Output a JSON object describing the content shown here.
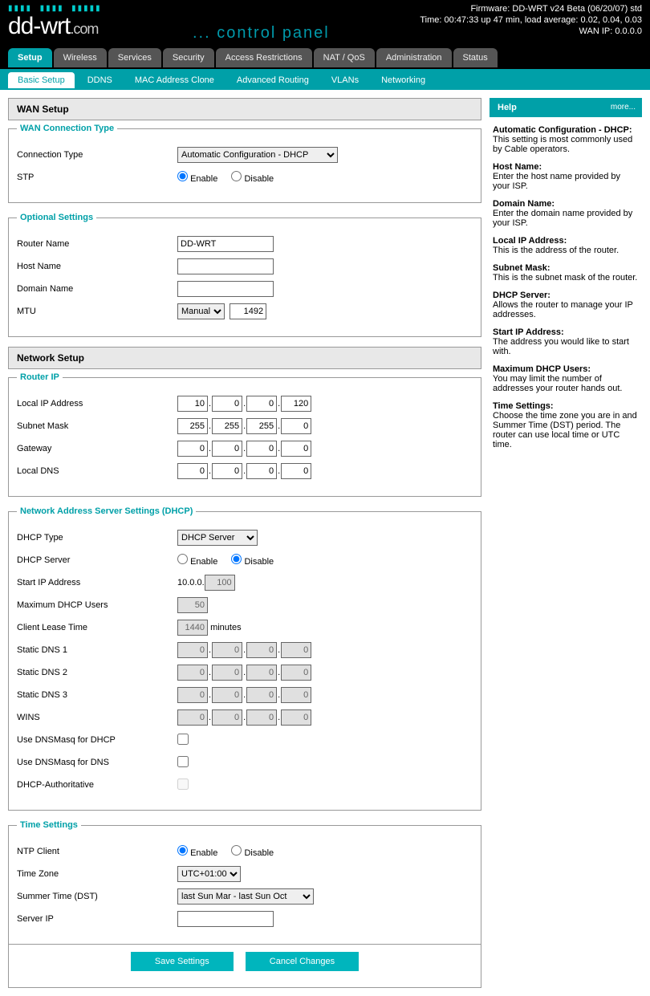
{
  "header": {
    "firmware": "Firmware: DD-WRT v24 Beta (06/20/07) std",
    "time": "Time: 00:47:33 up 47 min, load average: 0.02, 0.04, 0.03",
    "wanip": "WAN IP: 0.0.0.0",
    "logo_main": "dd-wrt",
    "logo_ext": ".com",
    "cp": "... control panel"
  },
  "tabs": {
    "main": [
      "Setup",
      "Wireless",
      "Services",
      "Security",
      "Access Restrictions",
      "NAT / QoS",
      "Administration",
      "Status"
    ],
    "active_main": 0,
    "sub": [
      "Basic Setup",
      "DDNS",
      "MAC Address Clone",
      "Advanced Routing",
      "VLANs",
      "Networking"
    ],
    "active_sub": 0
  },
  "sections": {
    "wan_setup": "WAN Setup",
    "network_setup": "Network Setup"
  },
  "wan": {
    "legend": "WAN Connection Type",
    "conn_label": "Connection Type",
    "conn_value": "Automatic Configuration - DHCP",
    "stp_label": "STP",
    "enable": "Enable",
    "disable": "Disable"
  },
  "optional": {
    "legend": "Optional Settings",
    "router_name_label": "Router Name",
    "router_name": "DD-WRT",
    "host_label": "Host Name",
    "host": "",
    "domain_label": "Domain Name",
    "domain": "",
    "mtu_label": "MTU",
    "mtu_mode": "Manual",
    "mtu": "1492"
  },
  "routerip": {
    "legend": "Router IP",
    "localip_label": "Local IP Address",
    "localip": [
      "10",
      "0",
      "0",
      "120"
    ],
    "subnet_label": "Subnet Mask",
    "subnet": [
      "255",
      "255",
      "255",
      "0"
    ],
    "gateway_label": "Gateway",
    "gateway": [
      "0",
      "0",
      "0",
      "0"
    ],
    "localdns_label": "Local DNS",
    "localdns": [
      "0",
      "0",
      "0",
      "0"
    ]
  },
  "dhcp": {
    "legend": "Network Address Server Settings (DHCP)",
    "type_label": "DHCP Type",
    "type_value": "DHCP Server",
    "server_label": "DHCP Server",
    "enable": "Enable",
    "disable": "Disable",
    "startip_label": "Start IP Address",
    "startip_prefix": "10.0.0.",
    "startip": "100",
    "maxusers_label": "Maximum DHCP Users",
    "maxusers": "50",
    "lease_label": "Client Lease Time",
    "lease": "1440",
    "lease_unit": "minutes",
    "dns1_label": "Static DNS 1",
    "dns1": [
      "0",
      "0",
      "0",
      "0"
    ],
    "dns2_label": "Static DNS 2",
    "dns2": [
      "0",
      "0",
      "0",
      "0"
    ],
    "dns3_label": "Static DNS 3",
    "dns3": [
      "0",
      "0",
      "0",
      "0"
    ],
    "wins_label": "WINS",
    "wins": [
      "0",
      "0",
      "0",
      "0"
    ],
    "dnsmasq_dhcp_label": "Use DNSMasq for DHCP",
    "dnsmasq_dns_label": "Use DNSMasq for DNS",
    "authoritative_label": "DHCP-Authoritative"
  },
  "time": {
    "legend": "Time Settings",
    "ntp_label": "NTP Client",
    "enable": "Enable",
    "disable": "Disable",
    "tz_label": "Time Zone",
    "tz": "UTC+01:00",
    "dst_label": "Summer Time (DST)",
    "dst": "last Sun Mar - last Sun Oct",
    "server_label": "Server IP",
    "server": ""
  },
  "buttons": {
    "save": "Save Settings",
    "cancel": "Cancel Changes"
  },
  "help": {
    "title": "Help",
    "more": "more...",
    "items": [
      {
        "h": "Automatic Configuration - DHCP:",
        "t": "This setting is most commonly used by Cable operators."
      },
      {
        "h": "Host Name:",
        "t": "Enter the host name provided by your ISP."
      },
      {
        "h": "Domain Name:",
        "t": "Enter the domain name provided by your ISP."
      },
      {
        "h": "Local IP Address:",
        "t": "This is the address of the router."
      },
      {
        "h": "Subnet Mask:",
        "t": "This is the subnet mask of the router."
      },
      {
        "h": "DHCP Server:",
        "t": "Allows the router to manage your IP addresses."
      },
      {
        "h": "Start IP Address:",
        "t": "The address you would like to start with."
      },
      {
        "h": "Maximum DHCP Users:",
        "t": "You may limit the number of addresses your router hands out."
      },
      {
        "h": "Time Settings:",
        "t": "Choose the time zone you are in and Summer Time (DST) period. The router can use local time or UTC time."
      }
    ]
  }
}
